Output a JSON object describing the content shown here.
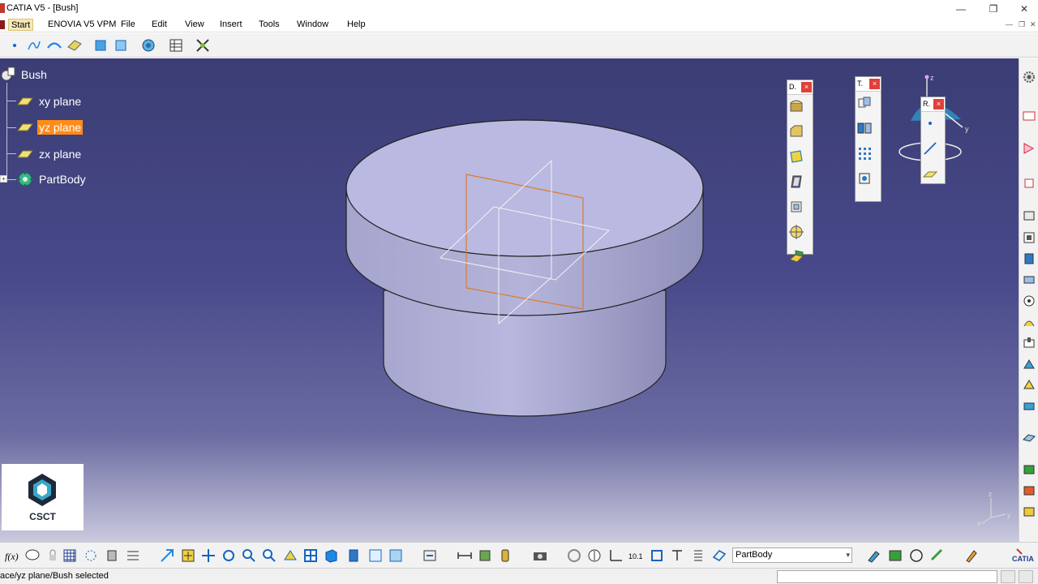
{
  "window": {
    "title": "CATIA V5 - [Bush]",
    "minimize": "—",
    "restore": "❐",
    "close": "✕"
  },
  "menu": {
    "items": [
      "Start",
      "ENOVIA V5 VPM",
      "File",
      "Edit",
      "View",
      "Insert",
      "Tools",
      "Window",
      "Help"
    ],
    "mdi_min": "—",
    "mdi_restore": "❐",
    "mdi_close": "✕"
  },
  "tree": {
    "root": "Bush",
    "children": [
      "xy plane",
      "yz plane",
      "zx plane",
      "PartBody"
    ],
    "selected": "yz plane"
  },
  "floating_toolbars": {
    "dress_up": {
      "name": "D.",
      "close": "×"
    },
    "transform": {
      "name": "T.",
      "close": "×"
    },
    "reference": {
      "name": "R.",
      "close": "×"
    }
  },
  "compass": {
    "z_label": "z",
    "y_label": "y"
  },
  "axis_triad": {
    "z_label": "z",
    "x_label": "x",
    "y_label": "y"
  },
  "logo": {
    "text": "CSCT"
  },
  "bottom_toolbar": {
    "current_body": "PartBody",
    "dropdown_arrow": "▾"
  },
  "status": {
    "message": "ace/yz plane/Bush selected"
  },
  "colors": {
    "selection": "#ff8c1a",
    "part_face": "#b8b8e0",
    "background_top": "#3b3d74",
    "background_bottom": "#c9c9de"
  }
}
